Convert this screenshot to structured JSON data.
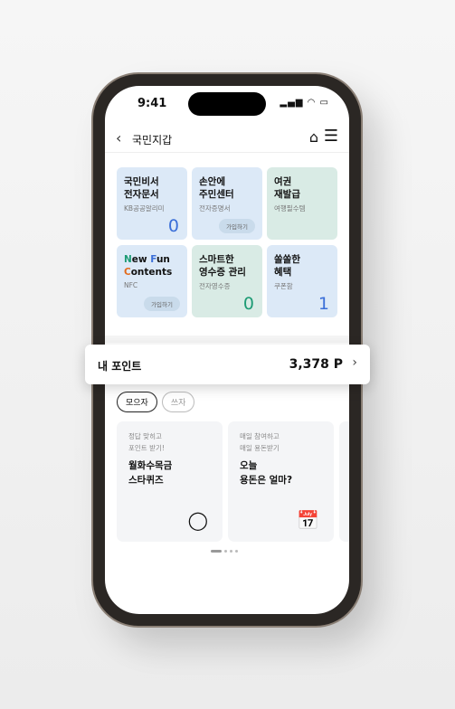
{
  "status": {
    "time": "9:41",
    "icons": "signal-wifi-battery"
  },
  "nav": {
    "title": "국민지갑",
    "back_icon": "chevron-left-icon",
    "home_icon": "home-icon",
    "menu_icon": "menu-icon"
  },
  "tiles": [
    {
      "title": "국민비서\n전자문서",
      "sub": "KB공공알리미",
      "count": "0"
    },
    {
      "title": "손안에\n주민센터",
      "sub": "전자증명서",
      "pill": "가입하기"
    },
    {
      "title": "여권\n재발급",
      "sub": "여행필수템"
    },
    {
      "title_parts": [
        "N",
        "ew ",
        "F",
        "un",
        "C",
        "ontents"
      ],
      "sub": "NFC",
      "pill": "가입하기"
    },
    {
      "title": "스마트한\n영수증 관리",
      "sub": "전자영수증",
      "count": "0"
    },
    {
      "title": "쏠쏠한\n혜택",
      "sub": "쿠폰함",
      "count": "1"
    }
  ],
  "points": {
    "label": "내 포인트",
    "value": "3,378 P"
  },
  "chips": [
    "모으자",
    "쓰자"
  ],
  "cards": [
    {
      "sub": "정답 맞히고\n포인트 받기!",
      "title": "월화수목금\n스타퀴즈",
      "icon": "speech-bubble-icon"
    },
    {
      "sub": "매일 참여하고\n매일 용돈받기",
      "title": "오늘\n용돈은 얼마?",
      "icon": "calendar-icon"
    }
  ],
  "colors": {
    "accent": "#3b6fd8",
    "green": "#1d9b74"
  }
}
